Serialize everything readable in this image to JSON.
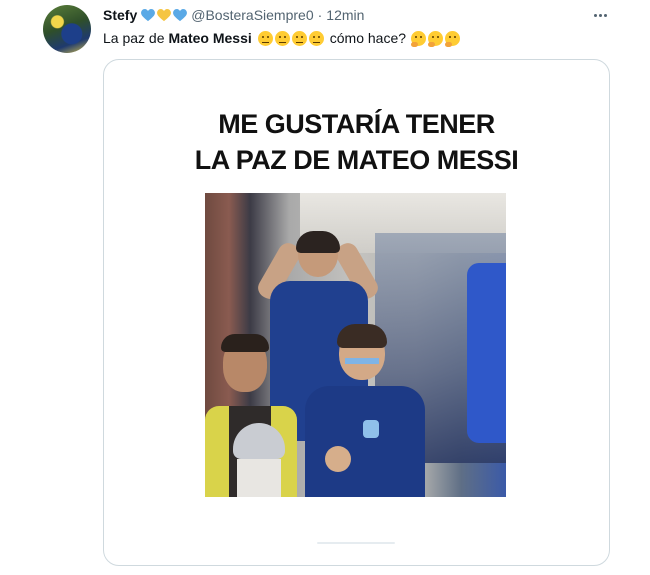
{
  "tweet": {
    "author": {
      "display_name": "Stefy",
      "handle": "@BosteraSiempre0",
      "name_emojis": [
        "blue-heart",
        "yellow-heart",
        "blue-heart"
      ]
    },
    "separator": "·",
    "time": "12min",
    "text": {
      "prefix": "La paz de",
      "bold": "Mateo Messi",
      "suffix": "cómo hace?",
      "face_emojis": [
        "thinking-face",
        "face-with-raised-eyebrow",
        "face-with-raised-eyebrow",
        "face-with-raised-eyebrow"
      ],
      "end_emojis": [
        "thinking-face",
        "thinking-face",
        "thinking-face"
      ]
    },
    "media": {
      "caption_line1": "ME GUSTARÍA TENER",
      "caption_line2": "LA PAZ DE MATEO MESSI"
    }
  },
  "colors": {
    "text_primary": "#0f1419",
    "text_secondary": "#536471",
    "heart_blue": "#5aa9e6",
    "heart_yellow": "#f5c542",
    "card_border": "#cfd9de"
  }
}
